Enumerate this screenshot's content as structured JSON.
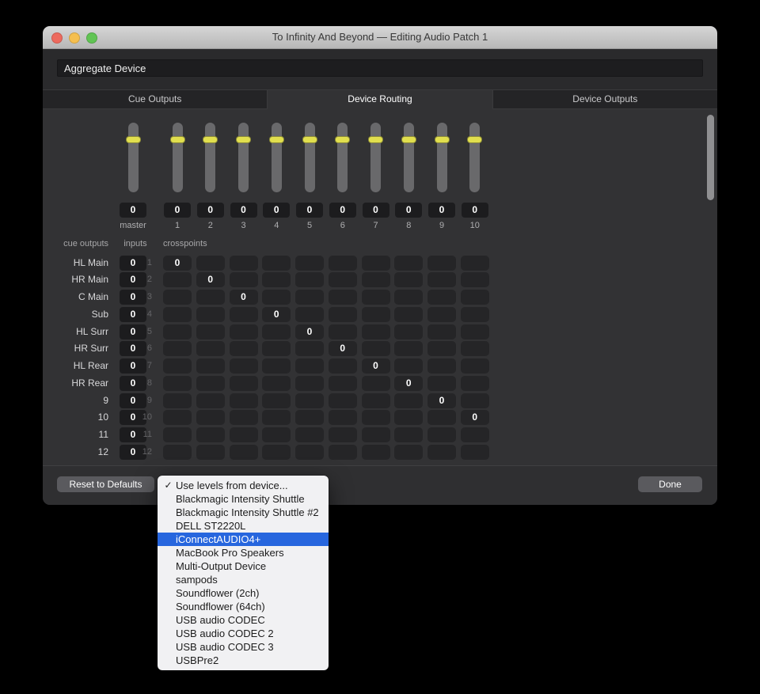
{
  "window": {
    "title": "To Infinity And Beyond — Editing Audio Patch 1",
    "name_field": {
      "value": "Aggregate Device"
    }
  },
  "tabs": [
    {
      "label": "Cue Outputs",
      "selected": false
    },
    {
      "label": "Device Routing",
      "selected": true
    },
    {
      "label": "Device Outputs",
      "selected": false
    }
  ],
  "mixer": {
    "channels": [
      {
        "label": "master",
        "value": "0"
      },
      {
        "label": "1",
        "value": "0"
      },
      {
        "label": "2",
        "value": "0"
      },
      {
        "label": "3",
        "value": "0"
      },
      {
        "label": "4",
        "value": "0"
      },
      {
        "label": "5",
        "value": "0"
      },
      {
        "label": "6",
        "value": "0"
      },
      {
        "label": "7",
        "value": "0"
      },
      {
        "label": "8",
        "value": "0"
      },
      {
        "label": "9",
        "value": "0"
      },
      {
        "label": "10",
        "value": "0"
      }
    ]
  },
  "matrix": {
    "corner_label": "cue outputs",
    "inputs_label": "inputs",
    "crosspoints_label": "crosspoints",
    "num_columns": 10,
    "rows": [
      {
        "label": "HL Main",
        "number": "1",
        "input_value": "0",
        "active_column": 1,
        "active_value": "0"
      },
      {
        "label": "HR Main",
        "number": "2",
        "input_value": "0",
        "active_column": 2,
        "active_value": "0"
      },
      {
        "label": "C Main",
        "number": "3",
        "input_value": "0",
        "active_column": 3,
        "active_value": "0"
      },
      {
        "label": "Sub",
        "number": "4",
        "input_value": "0",
        "active_column": 4,
        "active_value": "0"
      },
      {
        "label": "HL Surr",
        "number": "5",
        "input_value": "0",
        "active_column": 5,
        "active_value": "0"
      },
      {
        "label": "HR Surr",
        "number": "6",
        "input_value": "0",
        "active_column": 6,
        "active_value": "0"
      },
      {
        "label": "HL Rear",
        "number": "7",
        "input_value": "0",
        "active_column": 7,
        "active_value": "0"
      },
      {
        "label": "HR Rear",
        "number": "8",
        "input_value": "0",
        "active_column": 8,
        "active_value": "0"
      },
      {
        "label": "9",
        "number": "9",
        "input_value": "0",
        "active_column": 9,
        "active_value": "0"
      },
      {
        "label": "10",
        "number": "10",
        "input_value": "0",
        "active_column": 10,
        "active_value": "0"
      },
      {
        "label": "11",
        "number": "11",
        "input_value": "0",
        "active_column": null,
        "active_value": ""
      },
      {
        "label": "12",
        "number": "12",
        "input_value": "0",
        "active_column": null,
        "active_value": ""
      }
    ]
  },
  "footer": {
    "reset_label": "Reset to Defaults",
    "done_label": "Done"
  },
  "device_menu": {
    "items": [
      {
        "label": "Use levels from device...",
        "checked": true,
        "highlighted": false
      },
      {
        "label": "Blackmagic Intensity Shuttle",
        "checked": false,
        "highlighted": false
      },
      {
        "label": "Blackmagic Intensity Shuttle #2",
        "checked": false,
        "highlighted": false
      },
      {
        "label": "DELL ST2220L",
        "checked": false,
        "highlighted": false
      },
      {
        "label": "iConnectAUDIO4+",
        "checked": false,
        "highlighted": true
      },
      {
        "label": "MacBook Pro Speakers",
        "checked": false,
        "highlighted": false
      },
      {
        "label": "Multi-Output Device",
        "checked": false,
        "highlighted": false
      },
      {
        "label": "sampods",
        "checked": false,
        "highlighted": false
      },
      {
        "label": "Soundflower (2ch)",
        "checked": false,
        "highlighted": false
      },
      {
        "label": "Soundflower (64ch)",
        "checked": false,
        "highlighted": false
      },
      {
        "label": "USB audio CODEC",
        "checked": false,
        "highlighted": false
      },
      {
        "label": "USB audio CODEC 2",
        "checked": false,
        "highlighted": false
      },
      {
        "label": "USB audio CODEC 3",
        "checked": false,
        "highlighted": false
      },
      {
        "label": "USBPre2",
        "checked": false,
        "highlighted": false
      }
    ]
  },
  "colors": {
    "slider_handle": "#e1df4e",
    "menu_highlight": "#2766de",
    "traffic_red": "#ed6a5e",
    "traffic_yellow": "#f5bf4f",
    "traffic_green": "#61c454",
    "checkmark_glyph": "✓"
  }
}
